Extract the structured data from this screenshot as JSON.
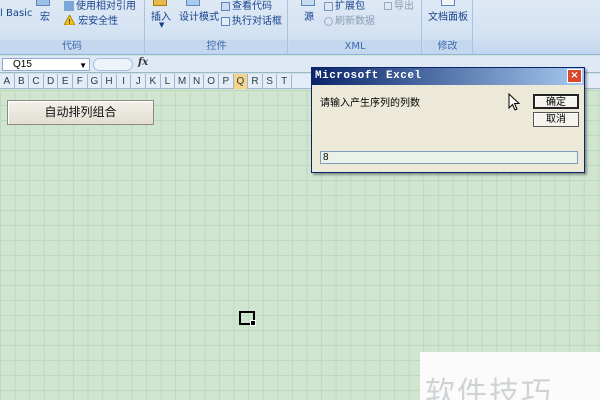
{
  "ribbon": {
    "code_group": {
      "label": "代码",
      "vb_label": "l Basic",
      "macro_label": "宏",
      "relative_ref_label": "使用相对引用",
      "macro_security_label": "宏安全性"
    },
    "controls_group": {
      "label": "控件",
      "insert_label": "插入",
      "design_mode_label": "设计模式",
      "view_code_label": "查看代码",
      "run_dialog_label": "执行对话框"
    },
    "xml_group": {
      "label": "XML",
      "source_label": "源",
      "expansion_pack_label": "扩展包",
      "refresh_data_label": "刷新数据",
      "export_label": "导出"
    },
    "modify_group": {
      "label": "修改",
      "doc_panel_label": "文档面板"
    }
  },
  "formula_bar": {
    "name_box": "Q15",
    "fx_label": "fx",
    "formula": ""
  },
  "columns": [
    "A",
    "B",
    "C",
    "D",
    "E",
    "F",
    "G",
    "H",
    "I",
    "J",
    "K",
    "L",
    "M",
    "N",
    "O",
    "P",
    "Q",
    "R",
    "S",
    "T"
  ],
  "selected_column": "Q",
  "sheet": {
    "macro_button_label": "自动排列组合"
  },
  "dialog": {
    "title": "Microsoft Excel",
    "close_label": "×",
    "prompt": "请输入产生序列的列数",
    "ok_label": "确定",
    "cancel_label": "取消",
    "input_value": "8"
  },
  "watermark": "软件技巧",
  "colors": {
    "sheet_bg": "#cfe5cf",
    "selected_header": "#f8d38b",
    "dialog_title_start": "#0a246a",
    "dialog_title_end": "#a6caf0"
  }
}
